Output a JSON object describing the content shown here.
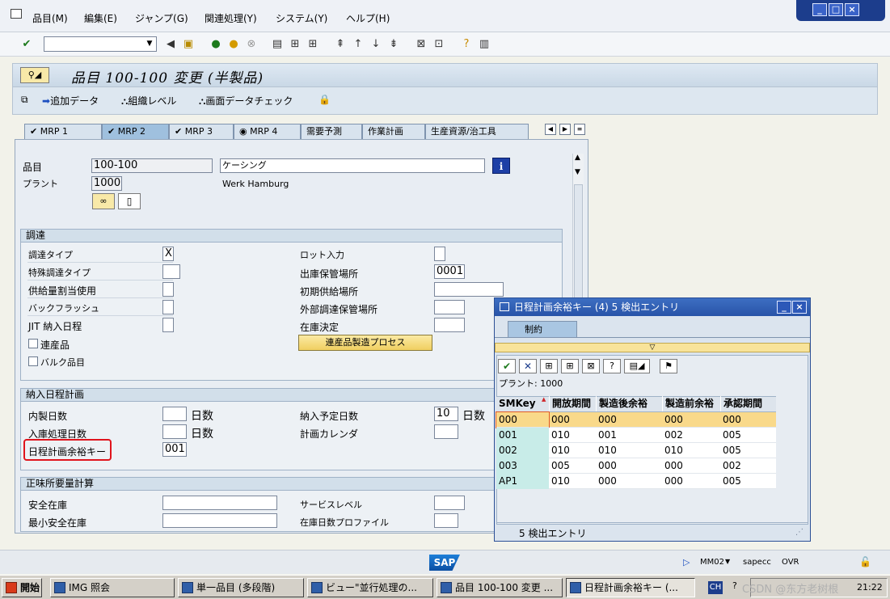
{
  "menu": {
    "items": [
      "品目(M)",
      "編集(E)",
      "ジャンプ(G)",
      "関連処理(Y)",
      "システム(Y)",
      "ヘルプ(H)"
    ]
  },
  "window_controls": [
    "_",
    "□",
    "×"
  ],
  "title": "品目 100-100 変更 (半製品)",
  "app_toolbar": {
    "add_data": "追加データ",
    "org_level": "組織レベル",
    "screen_check": "画面データチェック"
  },
  "tabs": [
    "MRP 1",
    "MRP 2",
    "MRP 3",
    "MRP 4",
    "需要予測",
    "作業計画",
    "生産資源/治工具"
  ],
  "header": {
    "material_label": "品目",
    "material_value": "100-100",
    "material_desc": "ケーシング",
    "plant_label": "プラント",
    "plant_value": "1000",
    "plant_desc": "Werk Hamburg"
  },
  "procurement": {
    "title": "調達",
    "proc_type_label": "調達タイプ",
    "proc_type_value": "X",
    "special_proc_label": "特殊調達タイプ",
    "quota_label": "供給量割当使用",
    "backflush_label": "バックフラッシュ",
    "jit_label": "JIT 納入日程",
    "coproduct_label": "連産品",
    "bulk_label": "バルク品目",
    "batch_entry_label": "ロット入力",
    "issue_sloc_label": "出庫保管場所",
    "issue_sloc_value": "0001",
    "default_supply_label": "初期供給場所",
    "ext_sloc_label": "外部調達保管場所",
    "stock_det_label": "在庫決定",
    "coproduct_button": "連産品製造プロセス"
  },
  "scheduling": {
    "title": "納入日程計画",
    "inhouse_label": "内製日数",
    "gr_label": "入庫処理日数",
    "sm_key_label": "日程計画余裕キー",
    "sm_key_value": "001",
    "days_unit": "日数",
    "planned_delivery_label": "納入予定日数",
    "planned_delivery_value": "10",
    "calendar_label": "計画カレンダ"
  },
  "net_req": {
    "title": "正味所要量計算",
    "safety_stock_label": "安全在庫",
    "min_safety_label": "最小安全在庫",
    "service_level_label": "サービスレベル",
    "coverage_profile_label": "在庫日数プロファイル"
  },
  "popup": {
    "title": "日程計画余裕キー (4)    5 検出エントリ",
    "tab_label": "制約",
    "plant_line": "プラント: 1000",
    "columns": [
      "SMKey",
      "開放期間",
      "製造後余裕",
      "製造前余裕",
      "承認期間"
    ],
    "rows": [
      [
        "000",
        "000",
        "000",
        "000",
        "000"
      ],
      [
        "001",
        "010",
        "001",
        "002",
        "005"
      ],
      [
        "002",
        "010",
        "010",
        "010",
        "005"
      ],
      [
        "003",
        "005",
        "000",
        "000",
        "002"
      ],
      [
        "AP1",
        "010",
        "000",
        "000",
        "005"
      ]
    ],
    "footer": "5 検出エントリ"
  },
  "status": {
    "sap_logo": "SAP",
    "transaction": "MM02",
    "server": "sapecc",
    "mode": "OVR"
  },
  "taskbar": {
    "start": "開始",
    "tasks": [
      "IMG 照会",
      "単一品目 (多段階)",
      "ビュー\"並行処理の...",
      "品目 100-100 変更 ...",
      "日程計画余裕キー (..."
    ],
    "lang": "CH",
    "time": "21:22",
    "watermark": "CSDN @东方老树根"
  },
  "colors": {
    "highlight_row": "#f9d98a",
    "key_column": "#c8ece8",
    "sap_blue": "#1c3d8c",
    "red_box": "#e0141c"
  }
}
